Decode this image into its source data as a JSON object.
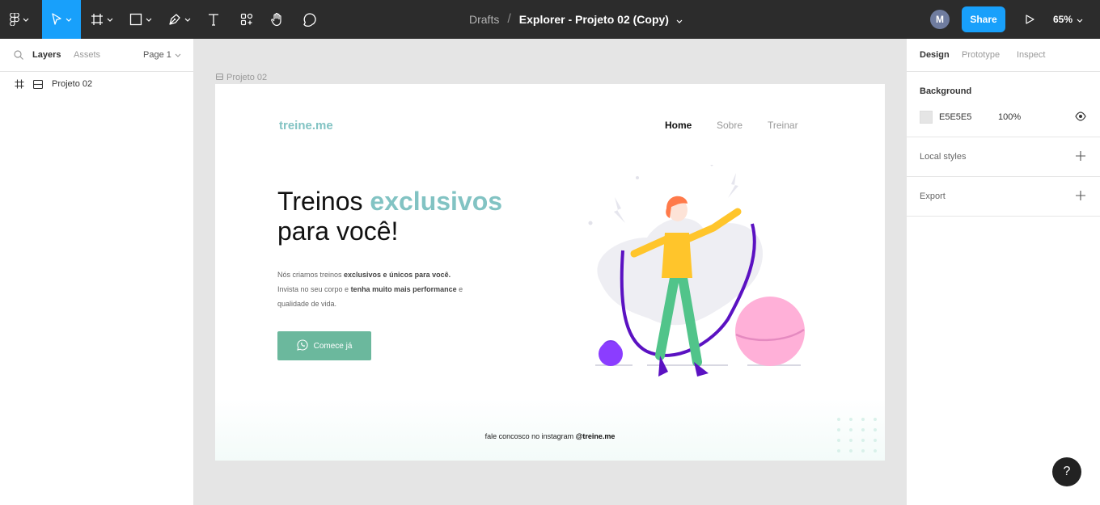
{
  "toolbar": {
    "tools": [
      {
        "name": "main-menu",
        "icon": "figma-logo-icon"
      },
      {
        "name": "move-tool",
        "icon": "cursor-arrow-icon"
      },
      {
        "name": "frame-tool",
        "icon": "frame-hash-icon"
      },
      {
        "name": "shape-tool",
        "icon": "rectangle-icon"
      },
      {
        "name": "pen-tool",
        "icon": "pen-nib-icon"
      },
      {
        "name": "text-tool",
        "icon": "text-T-icon"
      },
      {
        "name": "resources-tool",
        "icon": "resources-grid-icon"
      },
      {
        "name": "hand-tool",
        "icon": "hand-icon"
      },
      {
        "name": "comment-tool",
        "icon": "speech-bubble-icon"
      }
    ],
    "breadcrumb_parent": "Drafts",
    "breadcrumb_sep": "/",
    "file_name": "Explorer - Projeto 02 (Copy)",
    "avatar_initial": "M",
    "share_label": "Share",
    "zoom_label": "65%",
    "accent_color": "#18a0fb"
  },
  "left_panel": {
    "tab_layers": "Layers",
    "tab_assets": "Assets",
    "page_label": "Page 1",
    "layers": [
      {
        "name": "Projeto 02",
        "icon": "frame-icon"
      }
    ]
  },
  "right_panel": {
    "tab_design": "Design",
    "tab_prototype": "Prototype",
    "tab_inspect": "Inspect",
    "background_title": "Background",
    "background_hex": "E5E5E5",
    "background_opacity": "100%",
    "local_styles_label": "Local styles",
    "export_label": "Export",
    "help_label": "?"
  },
  "canvas": {
    "frame_label": "Projeto 02",
    "site": {
      "logo": "treine.me",
      "nav": [
        "Home",
        "Sobre",
        "Treinar"
      ],
      "headline_part1": "Treinos ",
      "headline_accent": "exclusivos",
      "headline_part2": "para você!",
      "para_1": "Nós criamos treinos ",
      "para_2": "exclusivos e únicos para você.",
      "para_3": "Invista no seu corpo e ",
      "para_4": "tenha muito mais performance",
      "para_5": " e qualidade de vida.",
      "cta_label": "Comece já",
      "footer_text": "fale concosco no instagram ",
      "footer_handle": "@treine.me",
      "accent_color": "#82c3c3",
      "button_color": "#6bb89d"
    }
  }
}
